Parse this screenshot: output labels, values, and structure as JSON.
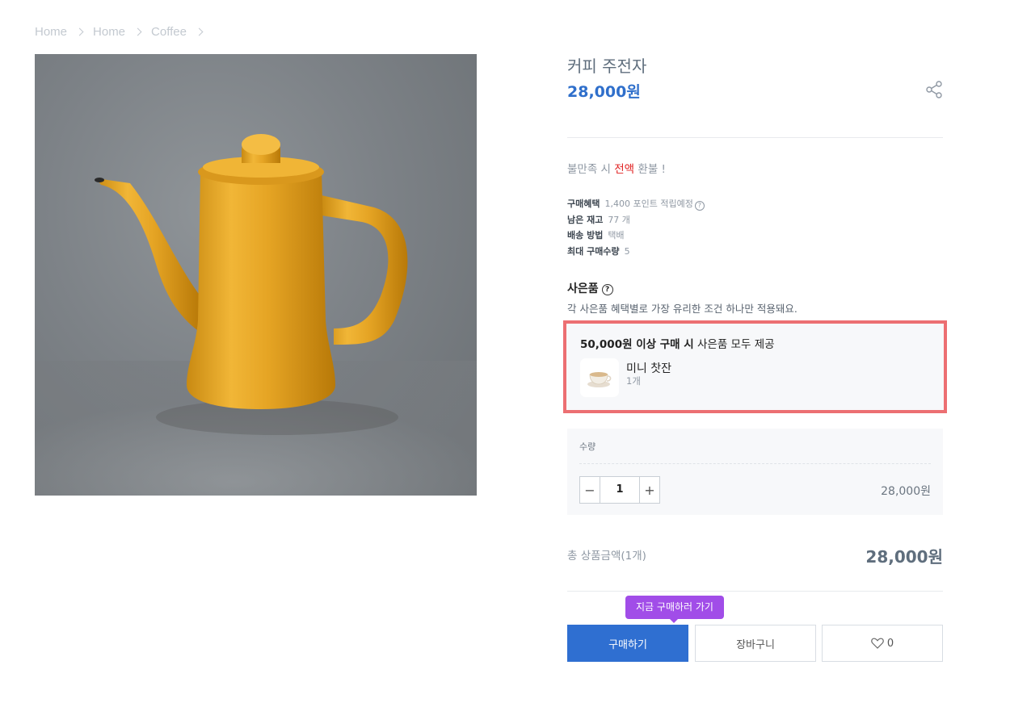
{
  "breadcrumb": [
    "Home",
    "Home",
    "Coffee"
  ],
  "product": {
    "title": "커피 주전자",
    "price": "28,000원",
    "refund_prefix": "불만족 시 ",
    "refund_emphasis": "전액",
    "refund_suffix": " 환불 !",
    "meta": [
      {
        "key": "구매혜택",
        "value": "1,400 포인트 적립예정"
      },
      {
        "key": "남은 재고",
        "value": "77 개"
      },
      {
        "key": "배송 방법",
        "value": "택배"
      },
      {
        "key": "최대 구매수량",
        "value": "5"
      }
    ],
    "help_icon": "?"
  },
  "gift": {
    "title": "사은품",
    "description": "각 사은품 혜택별로 가장 유리한 조건 하나만 적용돼요.",
    "condition_bold": "50,000원 이상 구매 시",
    "condition_rest": " 사은품 모두 제공",
    "item_name": "미니 찻잔",
    "item_qty": "1개"
  },
  "quantity": {
    "label": "수량",
    "value": "1",
    "minus": "−",
    "plus": "+",
    "line_price": "28,000원"
  },
  "total": {
    "label": "총 상품금액(1개)",
    "price": "28,000원"
  },
  "actions": {
    "tooltip": "지금 구매하러 가기",
    "buy": "구매하기",
    "cart": "장바구니",
    "like_count": "0"
  },
  "colors": {
    "accent": "#2f6fd1",
    "price": "#2f6fcb",
    "highlight_border": "#ec6f72",
    "tooltip": "#a14de8",
    "refund_emphasis": "#e02020"
  },
  "icons": [
    "chevron-right-icon",
    "share-icon",
    "help-icon",
    "minus-icon",
    "plus-icon",
    "heart-icon"
  ]
}
